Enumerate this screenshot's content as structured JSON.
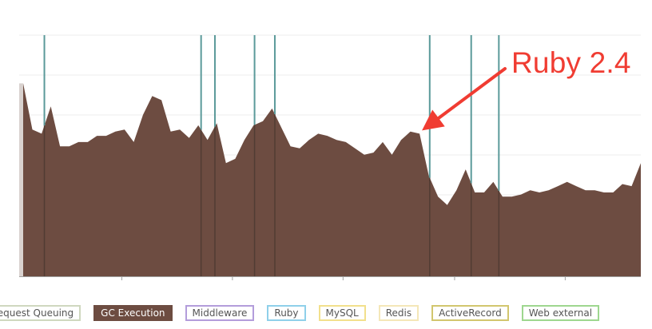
{
  "chart_data": {
    "type": "area",
    "title": "",
    "xlabel": "",
    "ylabel": "",
    "grid": true,
    "legend_placement": "bottom",
    "area_color": "#6d4c41",
    "marker_color": "#5b9a9a",
    "x": [
      0,
      1,
      2,
      3,
      4,
      5,
      6,
      7,
      8,
      9,
      10,
      11,
      12,
      13,
      14,
      15,
      16,
      17,
      18,
      19,
      20,
      21,
      22,
      23,
      24,
      25,
      26,
      27,
      28,
      29,
      30,
      31,
      32,
      33,
      34,
      35,
      36,
      37,
      38,
      39,
      40,
      41,
      42,
      43,
      44,
      45,
      46,
      47,
      48,
      49,
      50,
      51,
      52,
      53,
      54,
      55,
      56,
      57,
      58,
      59,
      60,
      61,
      62,
      63,
      64,
      65,
      66,
      67
    ],
    "values": [
      92,
      70,
      68,
      81,
      62,
      62,
      64,
      64,
      67,
      67,
      69,
      70,
      64,
      77,
      86,
      84,
      69,
      70,
      66,
      72,
      65,
      73,
      54,
      56,
      65,
      72,
      74,
      80,
      71,
      62,
      61,
      65,
      68,
      67,
      65,
      64,
      61,
      58,
      59,
      64,
      58,
      65,
      69,
      68,
      48,
      38,
      34,
      41,
      51,
      40,
      40,
      45,
      38,
      38,
      39,
      41,
      40,
      41,
      43,
      45,
      43,
      41,
      41,
      40,
      40,
      44,
      43,
      54
    ],
    "ylim": [
      0,
      115
    ],
    "deploy_markers_x": [
      2.3,
      19.3,
      20.8,
      25.1,
      27.3,
      44.1,
      48.6,
      51.6
    ],
    "x_ticks": [
      10.7,
      22.7,
      34.7,
      46.8,
      58.8
    ],
    "legend": [
      {
        "label": "Request Queuing",
        "color": "#cfd8bf",
        "active": false
      },
      {
        "label": "GC Execution",
        "color": "#6d4c41",
        "active": true
      },
      {
        "label": "Middleware",
        "color": "#b39ddb",
        "active": false
      },
      {
        "label": "Ruby",
        "color": "#8fd0ea",
        "active": false
      },
      {
        "label": "MySQL",
        "color": "#f2e08c",
        "active": false
      },
      {
        "label": "Redis",
        "color": "#f4e7b8",
        "active": false
      },
      {
        "label": "ActiveRecord",
        "color": "#d2c66e",
        "active": false
      },
      {
        "label": "Web external",
        "color": "#9ed78f",
        "active": false
      }
    ],
    "annotation": {
      "text": "Ruby 2.4",
      "color": "#f03c32",
      "target_index": 43
    }
  }
}
